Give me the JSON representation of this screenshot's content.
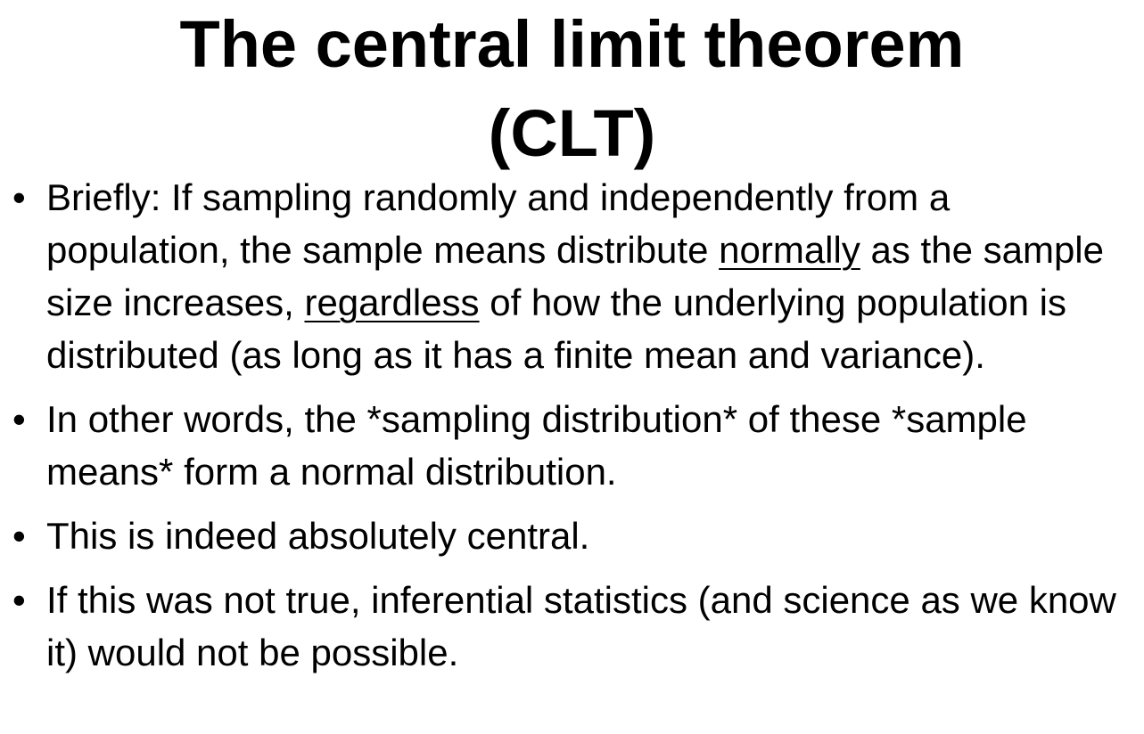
{
  "slide": {
    "title_line1": "The central limit theorem",
    "title_line2": "(CLT)",
    "bullet_glyph": "•",
    "bullets": [
      {
        "part1": "Briefly: If sampling randomly and independently from a population, the sample means distribute ",
        "underline1": "normally",
        "part2": " as the sample size increases, ",
        "underline2": "regardless",
        "part3": " of how the underlying population is distributed (as long as it has a finite mean and variance)."
      },
      {
        "text": "In other words, the *sampling distribution* of these *sample means* form a normal distribution."
      },
      {
        "text": "This is indeed absolutely central."
      },
      {
        "text": "If this was not true, inferential statistics (and science as we know it) would not be possible."
      }
    ]
  }
}
